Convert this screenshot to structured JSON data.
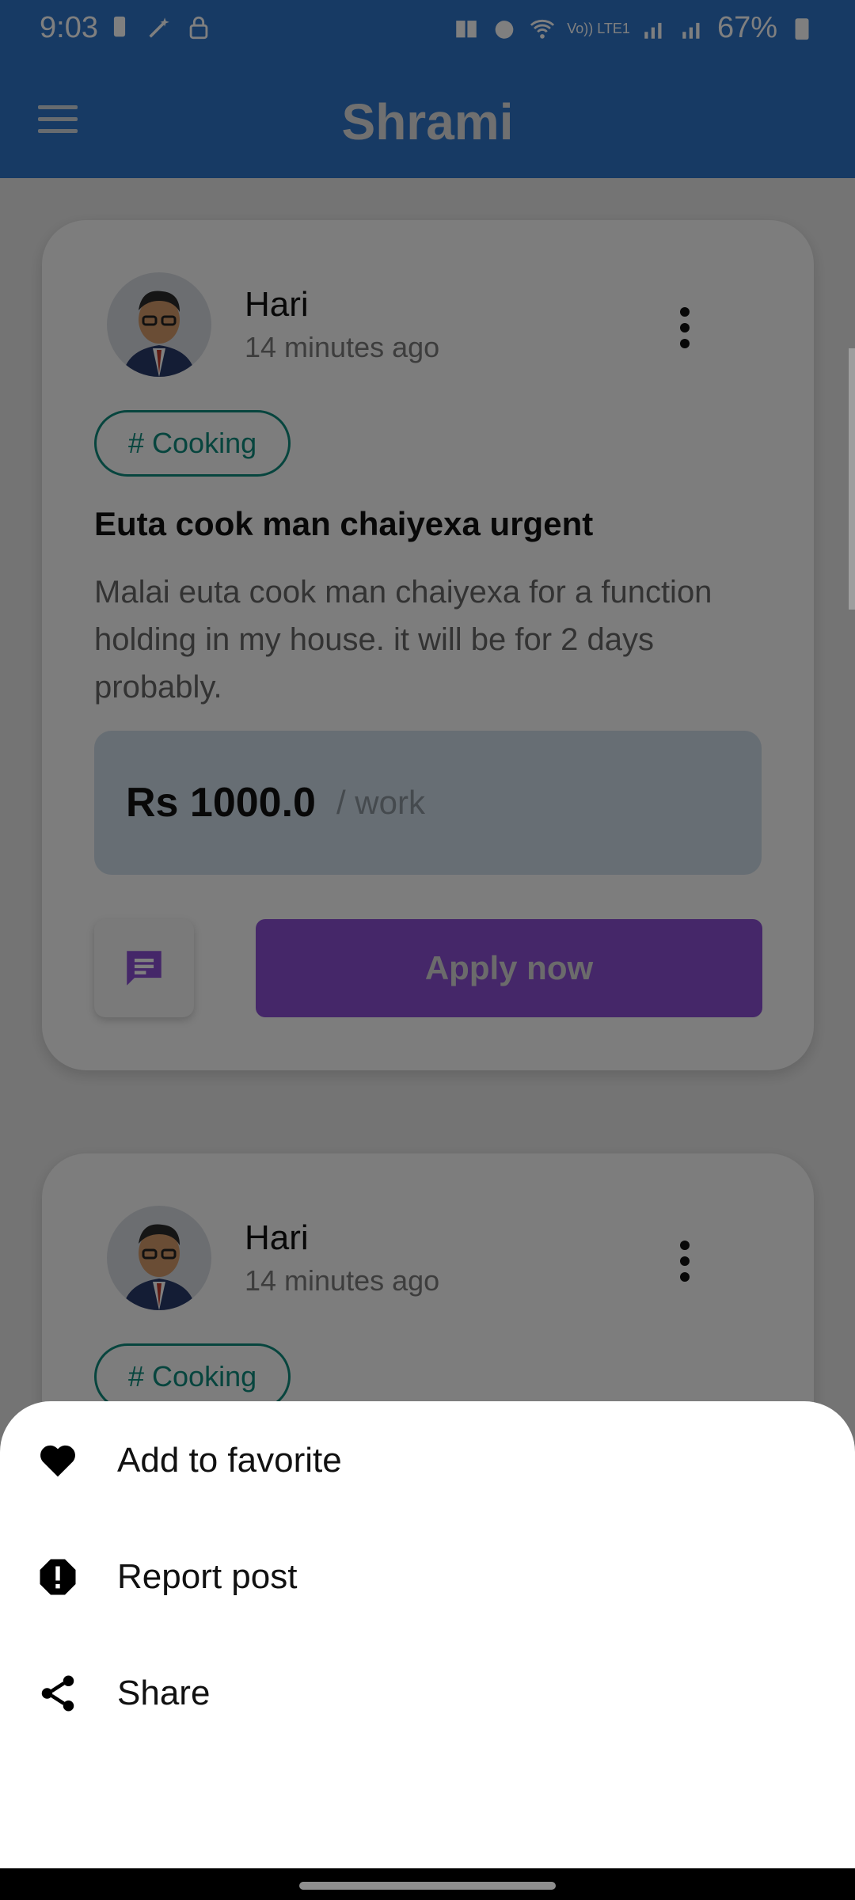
{
  "status_bar": {
    "time": "9:03",
    "battery": "67%",
    "network_label": "Vo)) LTE1"
  },
  "app_bar": {
    "title": "Shrami",
    "color": "#2f75c9"
  },
  "posts": [
    {
      "user": "Hari",
      "time_ago": "14 minutes ago",
      "tag": "# Cooking",
      "title": "Euta cook man chaiyexa urgent",
      "description": "Malai euta cook man chaiyexa for a function holding in my house. it will be for 2 days probably.",
      "price": "Rs 1000.0",
      "price_unit": "/ work",
      "apply_label": "Apply now"
    },
    {
      "user": "Hari",
      "time_ago": "14 minutes ago",
      "tag": "# Cooking"
    }
  ],
  "bottom_sheet": {
    "items": [
      {
        "label": "Add to favorite",
        "icon": "heart-icon"
      },
      {
        "label": "Report post",
        "icon": "report-icon"
      },
      {
        "label": "Share",
        "icon": "share-icon"
      }
    ]
  },
  "colors": {
    "accent_purple": "#8b4fd2",
    "tag_teal": "#0e8a7c",
    "price_bg": "#cfdce9"
  }
}
